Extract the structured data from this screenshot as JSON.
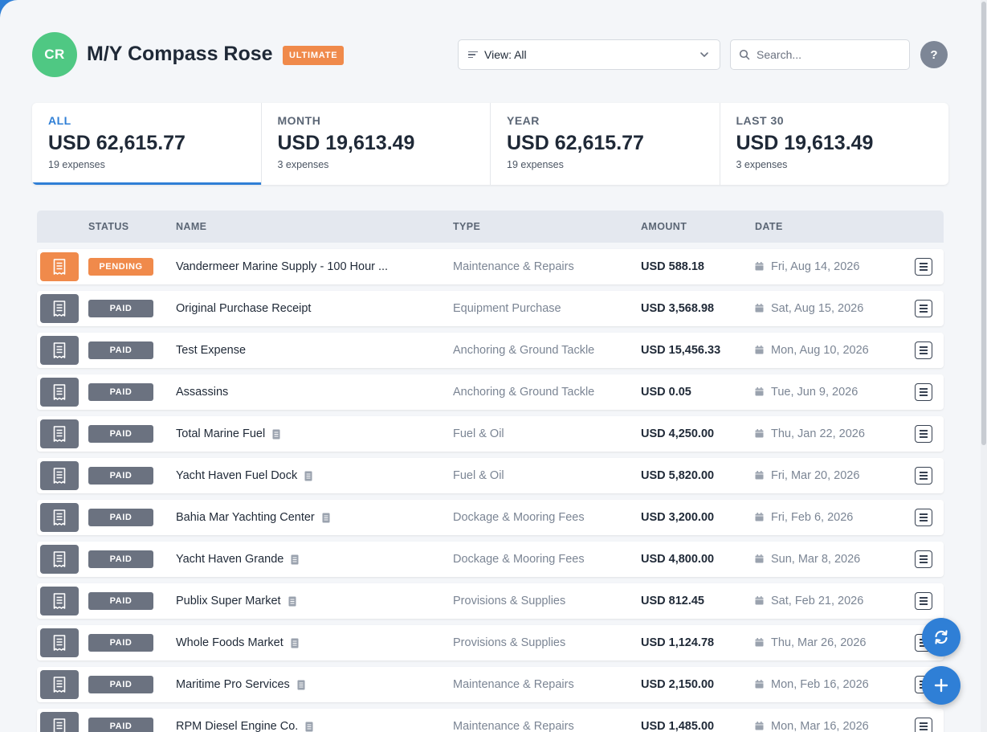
{
  "header": {
    "avatar_initials": "CR",
    "vessel_name": "M/Y Compass Rose",
    "plan_badge": "ULTIMATE",
    "view_label": "View: All",
    "search_placeholder": "Search...",
    "help_label": "?"
  },
  "summary": [
    {
      "label": "ALL",
      "value": "USD 62,615.77",
      "count": "19 expenses",
      "active": true
    },
    {
      "label": "MONTH",
      "value": "USD 19,613.49",
      "count": "3 expenses",
      "active": false
    },
    {
      "label": "YEAR",
      "value": "USD 62,615.77",
      "count": "19 expenses",
      "active": false
    },
    {
      "label": "LAST 30",
      "value": "USD 19,613.49",
      "count": "3 expenses",
      "active": false
    }
  ],
  "table": {
    "columns": {
      "status": "STATUS",
      "name": "NAME",
      "type": "TYPE",
      "amount": "AMOUNT",
      "date": "DATE"
    },
    "rows": [
      {
        "status": "PENDING",
        "name": "Vandermeer Marine Supply - 100 Hour ...",
        "has_doc": false,
        "type": "Maintenance & Repairs",
        "amount": "USD 588.18",
        "date": "Fri, Aug 14, 2026"
      },
      {
        "status": "PAID",
        "name": "Original Purchase Receipt",
        "has_doc": false,
        "type": "Equipment Purchase",
        "amount": "USD 3,568.98",
        "date": "Sat, Aug 15, 2026"
      },
      {
        "status": "PAID",
        "name": "Test Expense",
        "has_doc": false,
        "type": "Anchoring & Ground Tackle",
        "amount": "USD 15,456.33",
        "date": "Mon, Aug 10, 2026"
      },
      {
        "status": "PAID",
        "name": "Assassins",
        "has_doc": false,
        "type": "Anchoring & Ground Tackle",
        "amount": "USD 0.05",
        "date": "Tue, Jun 9, 2026"
      },
      {
        "status": "PAID",
        "name": "Total Marine Fuel",
        "has_doc": true,
        "type": "Fuel & Oil",
        "amount": "USD 4,250.00",
        "date": "Thu, Jan 22, 2026"
      },
      {
        "status": "PAID",
        "name": "Yacht Haven Fuel Dock",
        "has_doc": true,
        "type": "Fuel & Oil",
        "amount": "USD 5,820.00",
        "date": "Fri, Mar 20, 2026"
      },
      {
        "status": "PAID",
        "name": "Bahia Mar Yachting Center",
        "has_doc": true,
        "type": "Dockage & Mooring Fees",
        "amount": "USD 3,200.00",
        "date": "Fri, Feb 6, 2026"
      },
      {
        "status": "PAID",
        "name": "Yacht Haven Grande",
        "has_doc": true,
        "type": "Dockage & Mooring Fees",
        "amount": "USD 4,800.00",
        "date": "Sun, Mar 8, 2026"
      },
      {
        "status": "PAID",
        "name": "Publix Super Market",
        "has_doc": true,
        "type": "Provisions & Supplies",
        "amount": "USD 812.45",
        "date": "Sat, Feb 21, 2026"
      },
      {
        "status": "PAID",
        "name": "Whole Foods Market",
        "has_doc": true,
        "type": "Provisions & Supplies",
        "amount": "USD 1,124.78",
        "date": "Thu, Mar 26, 2026"
      },
      {
        "status": "PAID",
        "name": "Maritime Pro Services",
        "has_doc": true,
        "type": "Maintenance & Repairs",
        "amount": "USD 2,150.00",
        "date": "Mon, Feb 16, 2026"
      },
      {
        "status": "PAID",
        "name": "RPM Diesel Engine Co.",
        "has_doc": true,
        "type": "Maintenance & Repairs",
        "amount": "USD 1,485.00",
        "date": "Mon, Mar 16, 2026"
      }
    ]
  },
  "colors": {
    "accent": "#2f7fd6",
    "pending": "#f08a4b",
    "paid": "#6b7280",
    "avatar": "#4fc883"
  },
  "icons": {
    "receipt": "receipt-icon",
    "doc": "document-icon",
    "calendar": "calendar-icon",
    "menu": "menu-icon",
    "sync": "sync-icon",
    "add": "plus-icon",
    "search": "search-icon",
    "filter": "filter-icon",
    "chevron": "chevron-down-icon"
  }
}
